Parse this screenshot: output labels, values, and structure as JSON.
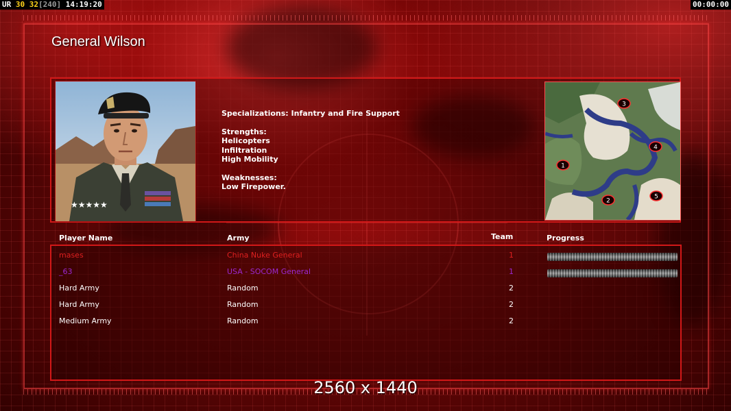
{
  "hud": {
    "left_segments": [
      {
        "text": "UR",
        "color": "#ffffff"
      },
      {
        "text": "30",
        "color": "#ffd21a"
      },
      {
        "text": "32",
        "color": "#ffd21a"
      },
      {
        "text": "[240]",
        "color": "#9a9a9a"
      },
      {
        "text": "14:19:20",
        "color": "#ffffff"
      }
    ],
    "timer": "00:00:00"
  },
  "general": {
    "title": "General Wilson",
    "specializations": "Specializations: Infantry and Fire Support",
    "strengths_label": "Strengths:",
    "strengths": [
      "Helicopters",
      "Infiltration",
      "High Mobility"
    ],
    "weaknesses_label": "Weaknesses:",
    "weaknesses": [
      "Low Firepower."
    ]
  },
  "map": {
    "start_positions": [
      "1",
      "2",
      "3",
      "4",
      "5"
    ]
  },
  "players_table": {
    "headers": {
      "name": "Player Name",
      "army": "Army",
      "team": "Team",
      "progress": "Progress"
    },
    "rows": [
      {
        "name": "mases",
        "army": "China Nuke General",
        "team": "1",
        "color": "#e02020",
        "progress": 1.0
      },
      {
        "name": "_63",
        "army": "USA - SOCOM General",
        "team": "1",
        "color": "#9a28d2",
        "progress": 1.0
      },
      {
        "name": "Hard Army",
        "army": "Random",
        "team": "2",
        "color": "#ffffff"
      },
      {
        "name": "Hard Army",
        "army": "Random",
        "team": "2",
        "color": "#ffffff"
      },
      {
        "name": "Medium Army",
        "army": "Random",
        "team": "2",
        "color": "#ffffff"
      }
    ]
  },
  "resolution_label": "2560 x 1440",
  "colors": {
    "accent_red": "#d21818",
    "hud_yellow": "#ffd21a",
    "text_white": "#ffffff"
  }
}
